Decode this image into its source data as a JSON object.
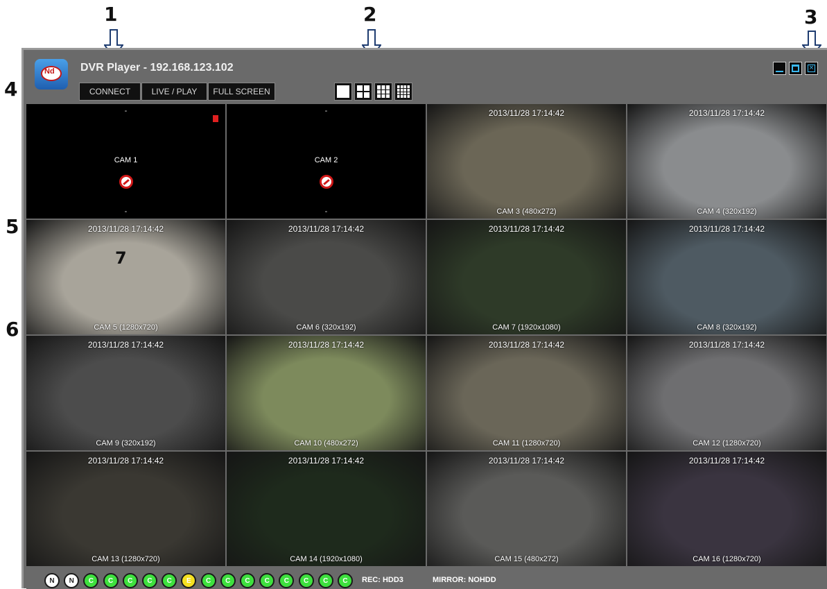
{
  "callouts": [
    "1",
    "2",
    "3",
    "4",
    "5",
    "6",
    "7"
  ],
  "app": {
    "title": "DVR Player - 192.168.123.102",
    "logo_text": "Nd"
  },
  "toolbar": {
    "connect": "CONNECT",
    "liveplay": "LIVE / PLAY",
    "fullscreen": "FULL SCREEN"
  },
  "layouts": [
    "1x1",
    "2x2",
    "3x3",
    "4x4"
  ],
  "window_controls": [
    "minimize",
    "restore",
    "close"
  ],
  "cameras": [
    {
      "ts": "-",
      "label": "-",
      "center": "CAM 1",
      "state": "no-signal",
      "audio": true
    },
    {
      "ts": "-",
      "label": "-",
      "center": "CAM 2",
      "state": "no-signal",
      "audio": false
    },
    {
      "ts": "2013/11/28  17:14:42",
      "label": "CAM 3 (480x272)",
      "color": "#6b6656",
      "selected": true
    },
    {
      "ts": "2013/11/28  17:14:42",
      "label": "CAM 4 (320x192)",
      "color": "#8a8c8e"
    },
    {
      "ts": "2013/11/28  17:14:42",
      "label": "CAM 5 (1280x720)",
      "color": "#a8a49a"
    },
    {
      "ts": "2013/11/28  17:14:42",
      "label": "CAM 6 (320x192)",
      "color": "#4a4a48"
    },
    {
      "ts": "2013/11/28  17:14:42",
      "label": "CAM 7 (1920x1080)",
      "color": "#2e3a28"
    },
    {
      "ts": "2013/11/28  17:14:42",
      "label": "CAM 8 (320x192)",
      "color": "#4e5a62"
    },
    {
      "ts": "2013/11/28  17:14:42",
      "label": "CAM 9 (320x192)",
      "color": "#4c4c4c"
    },
    {
      "ts": "2013/11/28  17:14:42",
      "label": "CAM 10 (480x272)",
      "color": "#7d8a5c"
    },
    {
      "ts": "2013/11/28  17:14:42",
      "label": "CAM 11 (1280x720)",
      "color": "#6a6658"
    },
    {
      "ts": "2013/11/28  17:14:42",
      "label": "CAM 12 (1280x720)",
      "color": "#6e6e70"
    },
    {
      "ts": "2013/11/28  17:14:42",
      "label": "CAM 13 (1280x720)",
      "color": "#3a3832"
    },
    {
      "ts": "2013/11/28  17:14:42",
      "label": "CAM 14 (1920x1080)",
      "color": "#1e2a1c"
    },
    {
      "ts": "2013/11/28  17:14:42",
      "label": "CAM 15 (480x272)",
      "color": "#5a5a58"
    },
    {
      "ts": "2013/11/28  17:14:42",
      "label": "CAM 16 (1280x720)",
      "color": "#3a3440"
    }
  ],
  "status_dots": [
    "N",
    "N",
    "C",
    "C",
    "C",
    "C",
    "C",
    "E",
    "C",
    "C",
    "C",
    "C",
    "C",
    "C",
    "C",
    "C"
  ],
  "status": {
    "rec": "REC: HDD3",
    "mirror": "MIRROR: NOHDD"
  }
}
